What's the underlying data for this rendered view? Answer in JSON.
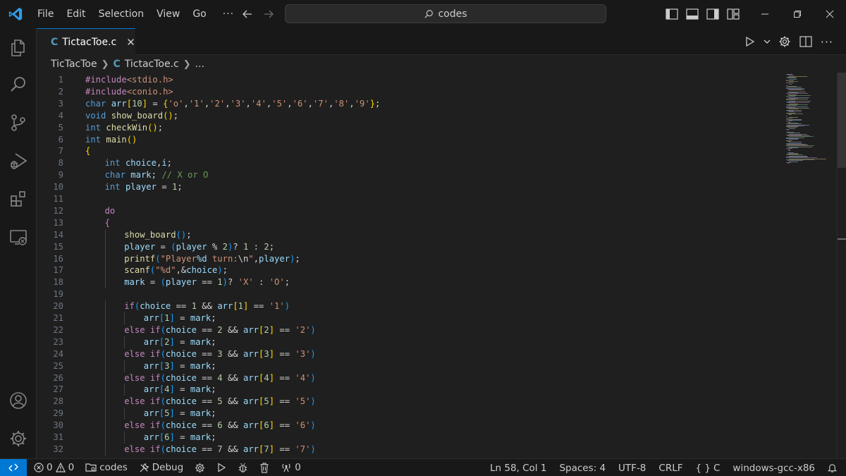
{
  "window": {
    "search_text": "codes",
    "menu": [
      "File",
      "Edit",
      "Selection",
      "View",
      "Go",
      "···"
    ]
  },
  "tab": {
    "icon_letter": "C",
    "label": "TictacToe.c",
    "close": "✕"
  },
  "breadcrumb": {
    "folder": "TicTacToe",
    "icon_letter": "C",
    "file": "TictacToe.c",
    "more": "..."
  },
  "editor": {
    "lines": [
      {
        "n": "1",
        "indent": 0,
        "tokens": [
          [
            "pp",
            "#include"
          ],
          [
            "str",
            "<stdio.h>"
          ]
        ]
      },
      {
        "n": "2",
        "indent": 0,
        "tokens": [
          [
            "pp",
            "#include"
          ],
          [
            "str",
            "<conio.h>"
          ]
        ]
      },
      {
        "n": "3",
        "indent": 0,
        "tokens": [
          [
            "kw",
            "char"
          ],
          [
            "op",
            " "
          ],
          [
            "var",
            "arr"
          ],
          [
            "br1",
            "["
          ],
          [
            "num",
            "10"
          ],
          [
            "br1",
            "]"
          ],
          [
            "op",
            " = "
          ],
          [
            "br1",
            "{"
          ],
          [
            "str",
            "'o'"
          ],
          [
            "op",
            ","
          ],
          [
            "str",
            "'1'"
          ],
          [
            "op",
            ","
          ],
          [
            "str",
            "'2'"
          ],
          [
            "op",
            ","
          ],
          [
            "str",
            "'3'"
          ],
          [
            "op",
            ","
          ],
          [
            "str",
            "'4'"
          ],
          [
            "op",
            ","
          ],
          [
            "str",
            "'5'"
          ],
          [
            "op",
            ","
          ],
          [
            "str",
            "'6'"
          ],
          [
            "op",
            ","
          ],
          [
            "str",
            "'7'"
          ],
          [
            "op",
            ","
          ],
          [
            "str",
            "'8'"
          ],
          [
            "op",
            ","
          ],
          [
            "str",
            "'9'"
          ],
          [
            "br1",
            "}"
          ],
          [
            "op",
            ";"
          ]
        ]
      },
      {
        "n": "4",
        "indent": 0,
        "tokens": [
          [
            "kw",
            "void"
          ],
          [
            "op",
            " "
          ],
          [
            "fn",
            "show_board"
          ],
          [
            "br1",
            "()"
          ],
          [
            "op",
            ";"
          ]
        ]
      },
      {
        "n": "5",
        "indent": 0,
        "tokens": [
          [
            "kw",
            "int"
          ],
          [
            "op",
            " "
          ],
          [
            "fn",
            "checkWin"
          ],
          [
            "br1",
            "()"
          ],
          [
            "op",
            ";"
          ]
        ]
      },
      {
        "n": "6",
        "indent": 0,
        "tokens": [
          [
            "kw",
            "int"
          ],
          [
            "op",
            " "
          ],
          [
            "fn",
            "main"
          ],
          [
            "br1",
            "()"
          ]
        ]
      },
      {
        "n": "7",
        "indent": 0,
        "tokens": [
          [
            "br1",
            "{"
          ]
        ]
      },
      {
        "n": "8",
        "indent": 1,
        "tokens": [
          [
            "kw",
            "int"
          ],
          [
            "op",
            " "
          ],
          [
            "var",
            "choice"
          ],
          [
            "op",
            ","
          ],
          [
            "var",
            "i"
          ],
          [
            "op",
            ";"
          ]
        ]
      },
      {
        "n": "9",
        "indent": 1,
        "tokens": [
          [
            "kw",
            "char"
          ],
          [
            "op",
            " "
          ],
          [
            "var",
            "mark"
          ],
          [
            "op",
            "; "
          ],
          [
            "cm",
            "// X or O"
          ]
        ]
      },
      {
        "n": "10",
        "indent": 1,
        "tokens": [
          [
            "kw",
            "int"
          ],
          [
            "op",
            " "
          ],
          [
            "var",
            "player"
          ],
          [
            "op",
            " = "
          ],
          [
            "num",
            "1"
          ],
          [
            "op",
            ";"
          ]
        ]
      },
      {
        "n": "11",
        "indent": 0,
        "tokens": []
      },
      {
        "n": "12",
        "indent": 1,
        "tokens": [
          [
            "ctl",
            "do"
          ]
        ]
      },
      {
        "n": "13",
        "indent": 1,
        "tokens": [
          [
            "br2",
            "{"
          ]
        ]
      },
      {
        "n": "14",
        "indent": 2,
        "tokens": [
          [
            "fn",
            "show_board"
          ],
          [
            "br3",
            "()"
          ],
          [
            "op",
            ";"
          ]
        ]
      },
      {
        "n": "15",
        "indent": 2,
        "tokens": [
          [
            "var",
            "player"
          ],
          [
            "op",
            " = "
          ],
          [
            "br3",
            "("
          ],
          [
            "var",
            "player"
          ],
          [
            "op",
            " % "
          ],
          [
            "num",
            "2"
          ],
          [
            "br3",
            ")"
          ],
          [
            "op",
            "? "
          ],
          [
            "num",
            "1"
          ],
          [
            "op",
            " : "
          ],
          [
            "num",
            "2"
          ],
          [
            "op",
            ";"
          ]
        ]
      },
      {
        "n": "16",
        "indent": 2,
        "tokens": [
          [
            "fn",
            "printf"
          ],
          [
            "br3",
            "("
          ],
          [
            "str",
            "\"Player"
          ],
          [
            "var",
            "%d"
          ],
          [
            "str",
            " turn:"
          ],
          [
            "op",
            "\\n"
          ],
          [
            "str",
            "\""
          ],
          [
            "op",
            ","
          ],
          [
            "var",
            "player"
          ],
          [
            "br3",
            ")"
          ],
          [
            "op",
            ";"
          ]
        ]
      },
      {
        "n": "17",
        "indent": 2,
        "tokens": [
          [
            "fn",
            "scanf"
          ],
          [
            "br3",
            "("
          ],
          [
            "str",
            "\"%d\""
          ],
          [
            "op",
            ",&"
          ],
          [
            "var",
            "choice"
          ],
          [
            "br3",
            ")"
          ],
          [
            "op",
            ";"
          ]
        ]
      },
      {
        "n": "18",
        "indent": 2,
        "tokens": [
          [
            "var",
            "mark"
          ],
          [
            "op",
            " = "
          ],
          [
            "br3",
            "("
          ],
          [
            "var",
            "player"
          ],
          [
            "op",
            " == "
          ],
          [
            "num",
            "1"
          ],
          [
            "br3",
            ")"
          ],
          [
            "op",
            "? "
          ],
          [
            "str",
            "'X'"
          ],
          [
            "op",
            " : "
          ],
          [
            "str",
            "'O'"
          ],
          [
            "op",
            ";"
          ]
        ]
      },
      {
        "n": "19",
        "indent": 0,
        "tokens": []
      },
      {
        "n": "20",
        "indent": 2,
        "tokens": [
          [
            "ctl",
            "if"
          ],
          [
            "br3",
            "("
          ],
          [
            "var",
            "choice"
          ],
          [
            "op",
            " == "
          ],
          [
            "num",
            "1"
          ],
          [
            "op",
            " && "
          ],
          [
            "var",
            "arr"
          ],
          [
            "br1",
            "["
          ],
          [
            "num",
            "1"
          ],
          [
            "br1",
            "]"
          ],
          [
            "op",
            " == "
          ],
          [
            "str",
            "'1'"
          ],
          [
            "br3",
            ")"
          ]
        ]
      },
      {
        "n": "21",
        "indent": 3,
        "tokens": [
          [
            "var",
            "arr"
          ],
          [
            "br3",
            "["
          ],
          [
            "num",
            "1"
          ],
          [
            "br3",
            "]"
          ],
          [
            "op",
            " = "
          ],
          [
            "var",
            "mark"
          ],
          [
            "op",
            ";"
          ]
        ]
      },
      {
        "n": "22",
        "indent": 2,
        "tokens": [
          [
            "ctl",
            "else if"
          ],
          [
            "br3",
            "("
          ],
          [
            "var",
            "choice"
          ],
          [
            "op",
            " == "
          ],
          [
            "num",
            "2"
          ],
          [
            "op",
            " && "
          ],
          [
            "var",
            "arr"
          ],
          [
            "br1",
            "["
          ],
          [
            "num",
            "2"
          ],
          [
            "br1",
            "]"
          ],
          [
            "op",
            " == "
          ],
          [
            "str",
            "'2'"
          ],
          [
            "br3",
            ")"
          ]
        ]
      },
      {
        "n": "23",
        "indent": 3,
        "tokens": [
          [
            "var",
            "arr"
          ],
          [
            "br3",
            "["
          ],
          [
            "num",
            "2"
          ],
          [
            "br3",
            "]"
          ],
          [
            "op",
            " = "
          ],
          [
            "var",
            "mark"
          ],
          [
            "op",
            ";"
          ]
        ]
      },
      {
        "n": "24",
        "indent": 2,
        "tokens": [
          [
            "ctl",
            "else if"
          ],
          [
            "br3",
            "("
          ],
          [
            "var",
            "choice"
          ],
          [
            "op",
            " == "
          ],
          [
            "num",
            "3"
          ],
          [
            "op",
            " && "
          ],
          [
            "var",
            "arr"
          ],
          [
            "br1",
            "["
          ],
          [
            "num",
            "3"
          ],
          [
            "br1",
            "]"
          ],
          [
            "op",
            " == "
          ],
          [
            "str",
            "'3'"
          ],
          [
            "br3",
            ")"
          ]
        ]
      },
      {
        "n": "25",
        "indent": 3,
        "tokens": [
          [
            "var",
            "arr"
          ],
          [
            "br3",
            "["
          ],
          [
            "num",
            "3"
          ],
          [
            "br3",
            "]"
          ],
          [
            "op",
            " = "
          ],
          [
            "var",
            "mark"
          ],
          [
            "op",
            ";"
          ]
        ]
      },
      {
        "n": "26",
        "indent": 2,
        "tokens": [
          [
            "ctl",
            "else if"
          ],
          [
            "br3",
            "("
          ],
          [
            "var",
            "choice"
          ],
          [
            "op",
            " == "
          ],
          [
            "num",
            "4"
          ],
          [
            "op",
            " && "
          ],
          [
            "var",
            "arr"
          ],
          [
            "br1",
            "["
          ],
          [
            "num",
            "4"
          ],
          [
            "br1",
            "]"
          ],
          [
            "op",
            " == "
          ],
          [
            "str",
            "'4'"
          ],
          [
            "br3",
            ")"
          ]
        ]
      },
      {
        "n": "27",
        "indent": 3,
        "tokens": [
          [
            "var",
            "arr"
          ],
          [
            "br3",
            "["
          ],
          [
            "num",
            "4"
          ],
          [
            "br3",
            "]"
          ],
          [
            "op",
            " = "
          ],
          [
            "var",
            "mark"
          ],
          [
            "op",
            ";"
          ]
        ]
      },
      {
        "n": "28",
        "indent": 2,
        "tokens": [
          [
            "ctl",
            "else if"
          ],
          [
            "br3",
            "("
          ],
          [
            "var",
            "choice"
          ],
          [
            "op",
            " == "
          ],
          [
            "num",
            "5"
          ],
          [
            "op",
            " && "
          ],
          [
            "var",
            "arr"
          ],
          [
            "br1",
            "["
          ],
          [
            "num",
            "5"
          ],
          [
            "br1",
            "]"
          ],
          [
            "op",
            " == "
          ],
          [
            "str",
            "'5'"
          ],
          [
            "br3",
            ")"
          ]
        ]
      },
      {
        "n": "29",
        "indent": 3,
        "tokens": [
          [
            "var",
            "arr"
          ],
          [
            "br3",
            "["
          ],
          [
            "num",
            "5"
          ],
          [
            "br3",
            "]"
          ],
          [
            "op",
            " = "
          ],
          [
            "var",
            "mark"
          ],
          [
            "op",
            ";"
          ]
        ]
      },
      {
        "n": "30",
        "indent": 2,
        "tokens": [
          [
            "ctl",
            "else if"
          ],
          [
            "br3",
            "("
          ],
          [
            "var",
            "choice"
          ],
          [
            "op",
            " == "
          ],
          [
            "num",
            "6"
          ],
          [
            "op",
            " && "
          ],
          [
            "var",
            "arr"
          ],
          [
            "br1",
            "["
          ],
          [
            "num",
            "6"
          ],
          [
            "br1",
            "]"
          ],
          [
            "op",
            " == "
          ],
          [
            "str",
            "'6'"
          ],
          [
            "br3",
            ")"
          ]
        ]
      },
      {
        "n": "31",
        "indent": 3,
        "tokens": [
          [
            "var",
            "arr"
          ],
          [
            "br3",
            "["
          ],
          [
            "num",
            "6"
          ],
          [
            "br3",
            "]"
          ],
          [
            "op",
            " = "
          ],
          [
            "var",
            "mark"
          ],
          [
            "op",
            ";"
          ]
        ]
      },
      {
        "n": "32",
        "indent": 2,
        "tokens": [
          [
            "ctl",
            "else if"
          ],
          [
            "br3",
            "("
          ],
          [
            "var",
            "choice"
          ],
          [
            "op",
            " == "
          ],
          [
            "num",
            "7"
          ],
          [
            "op",
            " && "
          ],
          [
            "var",
            "arr"
          ],
          [
            "br1",
            "["
          ],
          [
            "num",
            "7"
          ],
          [
            "br1",
            "]"
          ],
          [
            "op",
            " == "
          ],
          [
            "str",
            "'7'"
          ],
          [
            "br3",
            ")"
          ]
        ]
      }
    ]
  },
  "statusbar": {
    "errors": "0",
    "warnings": "0",
    "folder": "codes",
    "debug": "Debug",
    "ports": "0",
    "cursor": "Ln 58, Col 1",
    "spaces": "Spaces: 4",
    "encoding": "UTF-8",
    "eol": "CRLF",
    "language": "C",
    "config": "windows-gcc-x86"
  },
  "colors": {
    "accent": "#0078d4",
    "background": "#1f1f1f",
    "chrome": "#181818"
  }
}
